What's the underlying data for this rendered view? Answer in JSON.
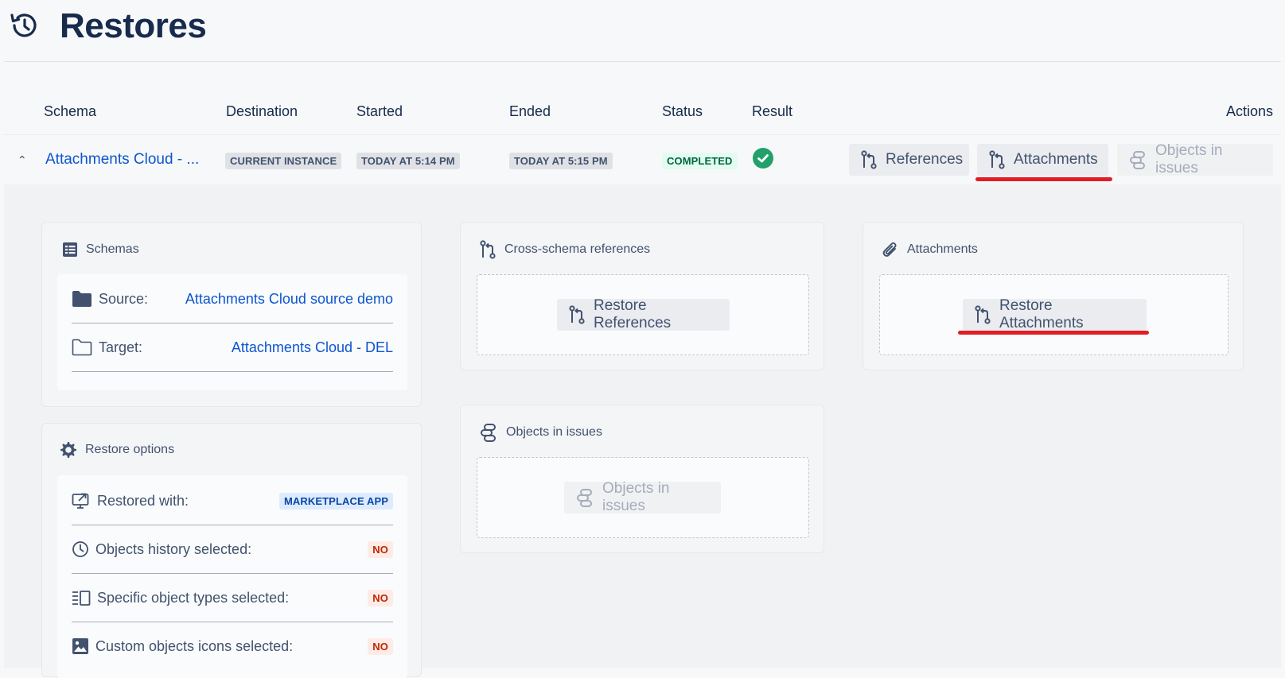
{
  "page": {
    "title": "Restores"
  },
  "table": {
    "headers": [
      "Schema",
      "Destination",
      "Started",
      "Ended",
      "Status",
      "Result",
      "Actions"
    ],
    "row": {
      "schema": "Attachments Cloud - ...",
      "destination": "CURRENT INSTANCE",
      "started": "TODAY AT 5:14 PM",
      "ended": "TODAY AT 5:15 PM",
      "status": "COMPLETED",
      "result_icon": "success-check-icon",
      "actions": [
        "References",
        "Attachments",
        "Objects in issues"
      ]
    }
  },
  "schemas_card": {
    "title": "Schemas",
    "source_label": "Source:",
    "source_value": "Attachments Cloud source demo",
    "target_label": "Target:",
    "target_value": "Attachments Cloud - DEL"
  },
  "restore_options_card": {
    "title": "Restore options",
    "rows": [
      {
        "label": "Restored with:",
        "value": "MARKETPLACE APP"
      },
      {
        "label": "Objects history selected:",
        "value": "NO"
      },
      {
        "label": "Specific object types selected:",
        "value": "NO"
      },
      {
        "label": "Custom objects icons selected:",
        "value": "NO"
      }
    ]
  },
  "references_card": {
    "title": "Cross-schema references",
    "button": "Restore References"
  },
  "attachments_card": {
    "title": "Attachments",
    "button": "Restore Attachments"
  },
  "objects_card": {
    "title": "Objects in issues",
    "button": "Objects in issues"
  },
  "colors": {
    "link": "#0c55cf",
    "highlight": "#e01e26",
    "success": "#22a06b"
  }
}
